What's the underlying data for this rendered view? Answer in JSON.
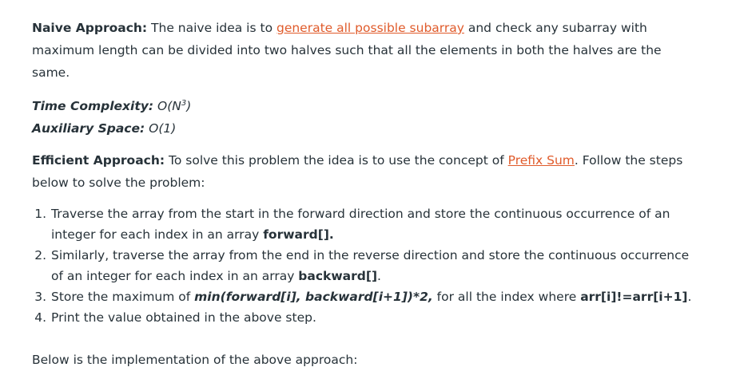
{
  "naive": {
    "label": "Naive Approach:",
    "text_before_link": " The naive idea is to ",
    "link": "generate all possible subarray",
    "text_after_link": " and check any subarray with maximum length can be divided into two halves such that all the elements in both the halves are the same."
  },
  "complexity": {
    "time_label": "Time Complexity:",
    "time_value": " O(N",
    "time_exp": "3",
    "time_close": ")",
    "space_label": "Auxiliary Space:",
    "space_value": " O(1)"
  },
  "efficient": {
    "label": "Efficient Approach:",
    "text_before_link": " To solve this problem the idea is to use the concept of ",
    "link": "Prefix Sum",
    "text_after_link": ". Follow the steps below to solve the problem:"
  },
  "steps": {
    "s1_text": "Traverse the array from the start in the forward direction and store the continuous occurrence of an integer for each index in an array ",
    "s1_bold": "forward[].",
    "s2_text": "Similarly, traverse the array from the end in the reverse direction and store the continuous occurrence of an integer for each index in an array ",
    "s2_bold": "backward[]",
    "s2_end": ".",
    "s3_text": "Store the maximum of ",
    "s3_bold_italic": "min(forward[i], backward[i+1])*2,",
    "s3_mid": " for all the index where ",
    "s3_bold": "arr[i]!=arr[i+1]",
    "s3_end": ".",
    "s4_text": "Print the value obtained in the above step."
  },
  "implementation": {
    "text": "Below is the implementation of the above approach:"
  }
}
